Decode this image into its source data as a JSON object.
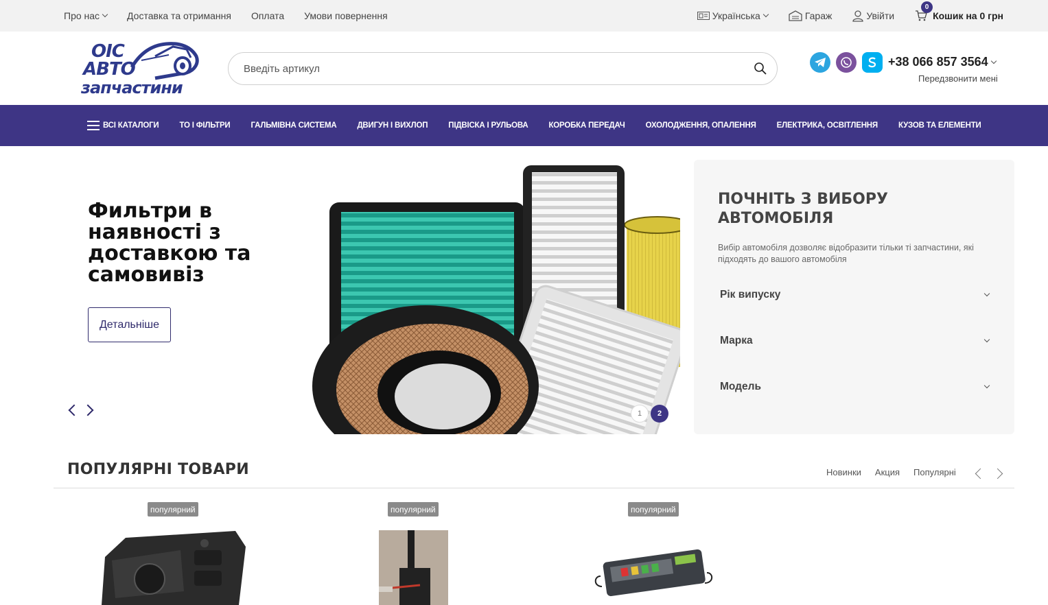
{
  "topbar": {
    "nav": [
      {
        "label": "Про нас",
        "dropdown": true
      },
      {
        "label": "Доставка та отримання"
      },
      {
        "label": "Оплата"
      },
      {
        "label": "Умови повернення"
      }
    ],
    "language": "Українська",
    "garage": "Гараж",
    "login": "Увійти",
    "cart_count": "0",
    "cart_label": "Кошик на 0 грн"
  },
  "header": {
    "logo": {
      "line1": "OIC",
      "line2": "АВТО",
      "line3": "запчастини"
    },
    "search_placeholder": "Введіть артикул",
    "phone": "+38 066 857 3564",
    "callback": "Передзвонити мені",
    "social": [
      "telegram-icon",
      "viber-icon",
      "skype-icon"
    ]
  },
  "catnav": {
    "all_catalogs": "ВСІ КАТАЛОГИ",
    "items": [
      "ТО І ФІЛЬТРИ",
      "ГАЛЬМІВНА СИСТЕМА",
      "ДВИГУН І ВИХЛОП",
      "ПІДВІСКА І РУЛЬОВА",
      "КОРОБКА ПЕРЕДАЧ",
      "ОХОЛОДЖЕННЯ, ОПАЛЕННЯ",
      "ЕЛЕКТРИКА, ОСВІТЛЕННЯ",
      "КУЗОВ ТА ЕЛЕМЕНТИ"
    ]
  },
  "hero": {
    "title": "Фильтри в наявності з доставкою та самовивіз",
    "button": "Детальніше",
    "slides": [
      "1",
      "2"
    ],
    "active_slide": 2
  },
  "car_select": {
    "title": "ПОЧНІТЬ З ВИБОРУ АВТОМОБІЛЯ",
    "description": "Вибір автомобіля дозволяє відобразити тільки ті запчастини, які підходять до вашого автомобіля",
    "fields": [
      "Рік випуску",
      "Марка",
      "Модель"
    ]
  },
  "popular": {
    "title": "ПОПУЛЯРНІ ТОВАРИ",
    "tabs": [
      "Новинки",
      "Акция",
      "Популярні"
    ],
    "products": [
      {
        "badge": "популярний"
      },
      {
        "badge": "популярний"
      },
      {
        "badge": "популярний"
      }
    ]
  },
  "colors": {
    "brand": "#3e3585",
    "topbar_bg": "#f2f2f2",
    "panel_bg": "#f6f6f6"
  }
}
